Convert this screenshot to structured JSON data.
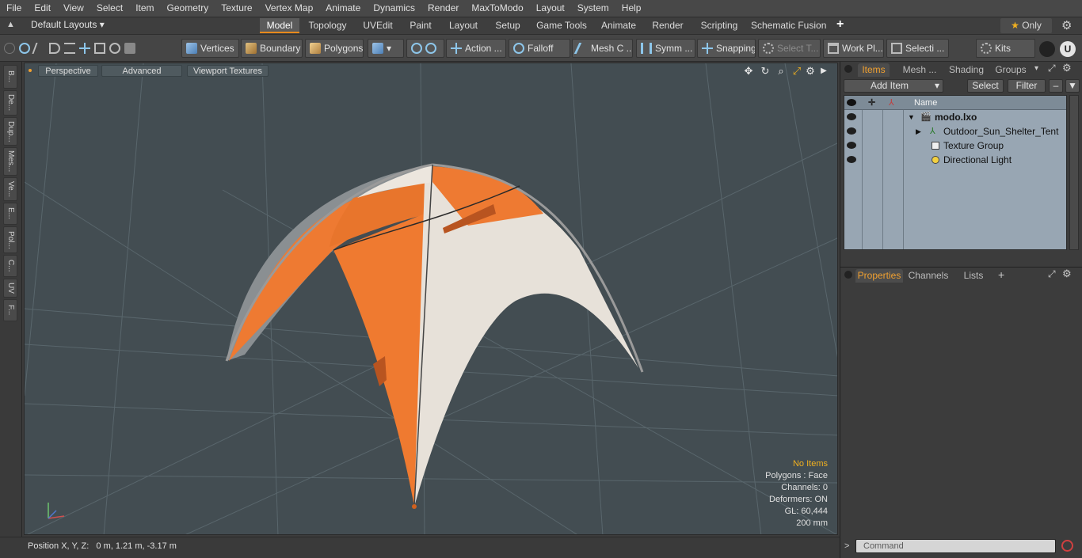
{
  "menubar": {
    "items": [
      "File",
      "Edit",
      "View",
      "Select",
      "Item",
      "Geometry",
      "Texture",
      "Vertex Map",
      "Animate",
      "Dynamics",
      "Render",
      "MaxToModo",
      "Layout",
      "System",
      "Help"
    ]
  },
  "tabbar": {
    "layout_dropdown": "Default Layouts",
    "tabs": [
      "Model",
      "Topology",
      "UVEdit",
      "Paint",
      "Layout",
      "Setup",
      "Game Tools",
      "Animate",
      "Render",
      "Scripting",
      "Schematic Fusion"
    ],
    "only_label": "Only"
  },
  "toolbar": {
    "vertices": "Vertices",
    "boundary": "Boundary",
    "polygons": "Polygons",
    "action": "Action ...",
    "falloff": "Falloff",
    "mesh_c": "Mesh C ...",
    "symm": "Symm ...",
    "snapping": "Snapping",
    "select_t": "Select T...",
    "work_pl": "Work Pl...",
    "selecti": "Selecti ...",
    "kits": "Kits"
  },
  "lefttabs": [
    "B...",
    "De...",
    "Dup...",
    "Mes...",
    "Ve...",
    "E...",
    "Pol...",
    "C...",
    "UV",
    "F..."
  ],
  "viewport": {
    "perspective": "Perspective",
    "advanced": "Advanced",
    "viewport_textures": "Viewport Textures",
    "info": {
      "no_items": "No Items",
      "polygons": "Polygons : Face",
      "channels": "Channels: 0",
      "deformers": "Deformers: ON",
      "gl": "GL: 60,444",
      "scale": "200 mm"
    }
  },
  "status": {
    "label": "Position X, Y, Z:",
    "value": "0 m, 1.21 m, -3.17 m"
  },
  "items_panel": {
    "tabs": [
      "Items",
      "Mesh ...",
      "Shading",
      "Groups"
    ],
    "add_item": "Add Item",
    "select": "Select",
    "filter": "Filter",
    "name_header": "Name",
    "rows": [
      "modo.lxo",
      "Outdoor_Sun_Shelter_Tent",
      "Texture Group",
      "Directional Light"
    ]
  },
  "properties_panel": {
    "tabs": [
      "Properties",
      "Channels",
      "Lists"
    ]
  },
  "command": {
    "placeholder": "Command"
  },
  "colors": {
    "accent": "#e8891c",
    "tent_orange": "#ee7a32",
    "tent_white": "#e6e0d8",
    "viewport_bg": "#434d52"
  }
}
